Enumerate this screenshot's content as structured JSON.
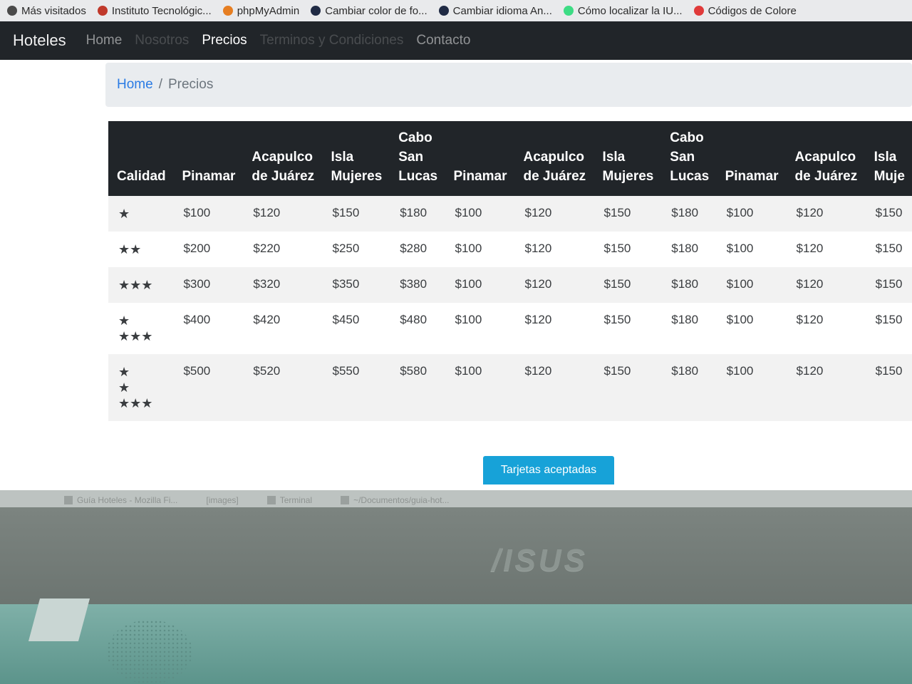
{
  "bookmarks": [
    {
      "label": "Más visitados",
      "icon": "gear-icon",
      "color": "#4a4a4a"
    },
    {
      "label": "Instituto Tecnológic...",
      "icon": "school-icon",
      "color": "#c0392b"
    },
    {
      "label": "phpMyAdmin",
      "icon": "phpmyadmin-icon",
      "color": "#e67e22"
    },
    {
      "label": "Cambiar color de fo...",
      "icon": "globe-icon",
      "color": "#1f2a44"
    },
    {
      "label": "Cambiar idioma An...",
      "icon": "globe-icon",
      "color": "#1f2a44"
    },
    {
      "label": "Cómo localizar la IU...",
      "icon": "android-icon",
      "color": "#3ddc84"
    },
    {
      "label": "Códigos de Colore",
      "icon": "color-icon",
      "color": "#e03a3a"
    }
  ],
  "navbar": {
    "brand": "Hoteles",
    "links": [
      {
        "label": "Home",
        "state": "normal"
      },
      {
        "label": "Nosotros",
        "state": "faint"
      },
      {
        "label": "Precios",
        "state": "active"
      },
      {
        "label": "Terminos y Condiciones",
        "state": "faint"
      },
      {
        "label": "Contacto",
        "state": "normal"
      }
    ]
  },
  "breadcrumb": {
    "home": "Home",
    "separator": "/",
    "current": "Precios"
  },
  "table": {
    "headers": [
      [
        "Calidad"
      ],
      [
        "Pinamar"
      ],
      [
        "Acapulco",
        "de Juárez"
      ],
      [
        "Isla",
        "Mujeres"
      ],
      [
        "Cabo",
        "San",
        "Lucas"
      ],
      [
        "Pinamar"
      ],
      [
        "Acapulco",
        "de Juárez"
      ],
      [
        "Isla",
        "Mujeres"
      ],
      [
        "Cabo",
        "San",
        "Lucas"
      ],
      [
        "Pinamar"
      ],
      [
        "Acapulco",
        "de Juárez"
      ],
      [
        "Isla",
        "Muje"
      ]
    ],
    "rows": [
      {
        "stars": [
          "★"
        ],
        "prices": [
          "$100",
          "$120",
          "$150",
          "$180",
          "$100",
          "$120",
          "$150",
          "$180",
          "$100",
          "$120",
          "$150"
        ]
      },
      {
        "stars": [
          "★★"
        ],
        "prices": [
          "$200",
          "$220",
          "$250",
          "$280",
          "$100",
          "$120",
          "$150",
          "$180",
          "$100",
          "$120",
          "$150"
        ]
      },
      {
        "stars": [
          "★★★"
        ],
        "prices": [
          "$300",
          "$320",
          "$350",
          "$380",
          "$100",
          "$120",
          "$150",
          "$180",
          "$100",
          "$120",
          "$150"
        ]
      },
      {
        "stars": [
          "★",
          "★★★"
        ],
        "prices": [
          "$400",
          "$420",
          "$450",
          "$480",
          "$100",
          "$120",
          "$150",
          "$180",
          "$100",
          "$120",
          "$150"
        ]
      },
      {
        "stars": [
          "★",
          "★",
          "★★★"
        ],
        "prices": [
          "$500",
          "$520",
          "$550",
          "$580",
          "$100",
          "$120",
          "$150",
          "$180",
          "$100",
          "$120",
          "$150"
        ]
      }
    ]
  },
  "cards_button": "Tarjetas aceptadas",
  "taskbar": [
    {
      "label": "Guía Hoteles - Mozilla Fi...",
      "icon": "firefox-icon"
    },
    {
      "label": "[images]",
      "icon": ""
    },
    {
      "label": "Terminal",
      "icon": "terminal-icon"
    },
    {
      "label": "~/Documentos/guia-hot...",
      "icon": "folder-icon"
    }
  ],
  "laptop_brand": "/ISUS"
}
